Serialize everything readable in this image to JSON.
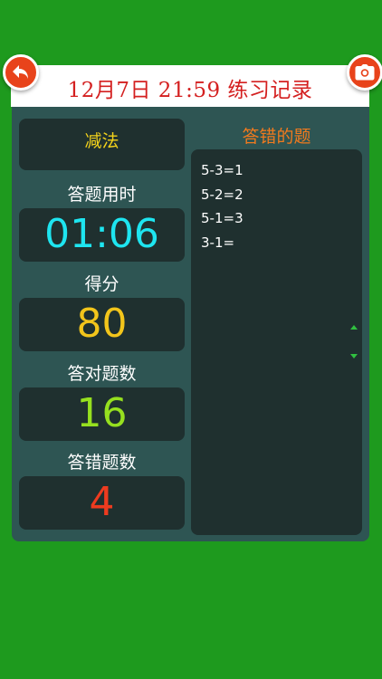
{
  "header": {
    "title": "12月7日  21:59  练习记录",
    "back_icon": "back-arrow-icon",
    "camera_icon": "camera-icon",
    "button_color": "#e8431b",
    "title_color": "#d42020"
  },
  "summary": {
    "mode": "减法",
    "time_label": "答题用时",
    "time_value": "01:06",
    "score_label": "得分",
    "score_value": "80",
    "correct_label": "答对题数",
    "correct_value": "16",
    "wrong_label": "答错题数",
    "wrong_value": "4"
  },
  "wrong_list": {
    "title": "答错的题",
    "items": [
      "5-3=1",
      "5-2=2",
      "5-1=3",
      "3-1="
    ]
  },
  "colors": {
    "background": "#1e9a1e",
    "panel": "#2e5553",
    "box": "#1f302f",
    "time": "#1ee5f0",
    "score": "#f2c51b",
    "correct": "#96e01f",
    "wrong": "#ee3b1f"
  }
}
